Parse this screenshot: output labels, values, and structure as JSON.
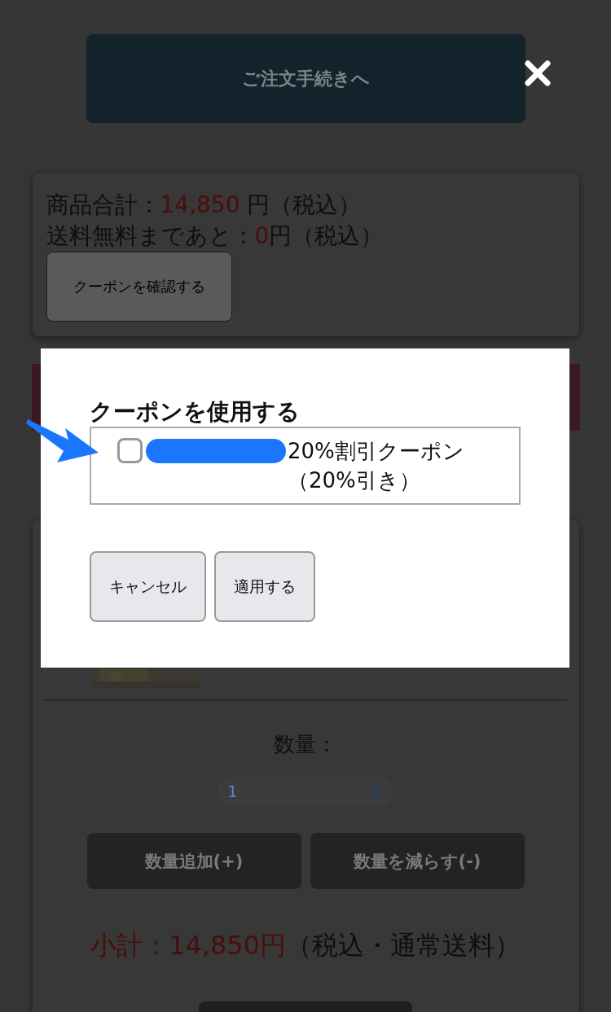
{
  "checkout_button": "ご注文手続きへ",
  "summary": {
    "total_label": "商品合計：",
    "total_value": "14,850",
    "total_suffix": "円（税込）",
    "free_shipping_label": "送料無料まであと：",
    "free_shipping_value": "0",
    "free_shipping_suffix": "円（税込）",
    "coupon_button": "クーポンを確認する"
  },
  "quantity": {
    "label": "数量：",
    "value": "1",
    "buttons": [
      "数量追加(+)",
      "数量を減らす(-)"
    ]
  },
  "subtotal": {
    "amount": "小計：14,850円",
    "note": "（税込・通常送料）"
  },
  "modal": {
    "title": "クーポンを使用する",
    "coupons": [
      {
        "label": "20%割引クーポン（20%引き）",
        "checked": false
      }
    ],
    "buttons": [
      "キャンセル",
      "適用する"
    ]
  }
}
